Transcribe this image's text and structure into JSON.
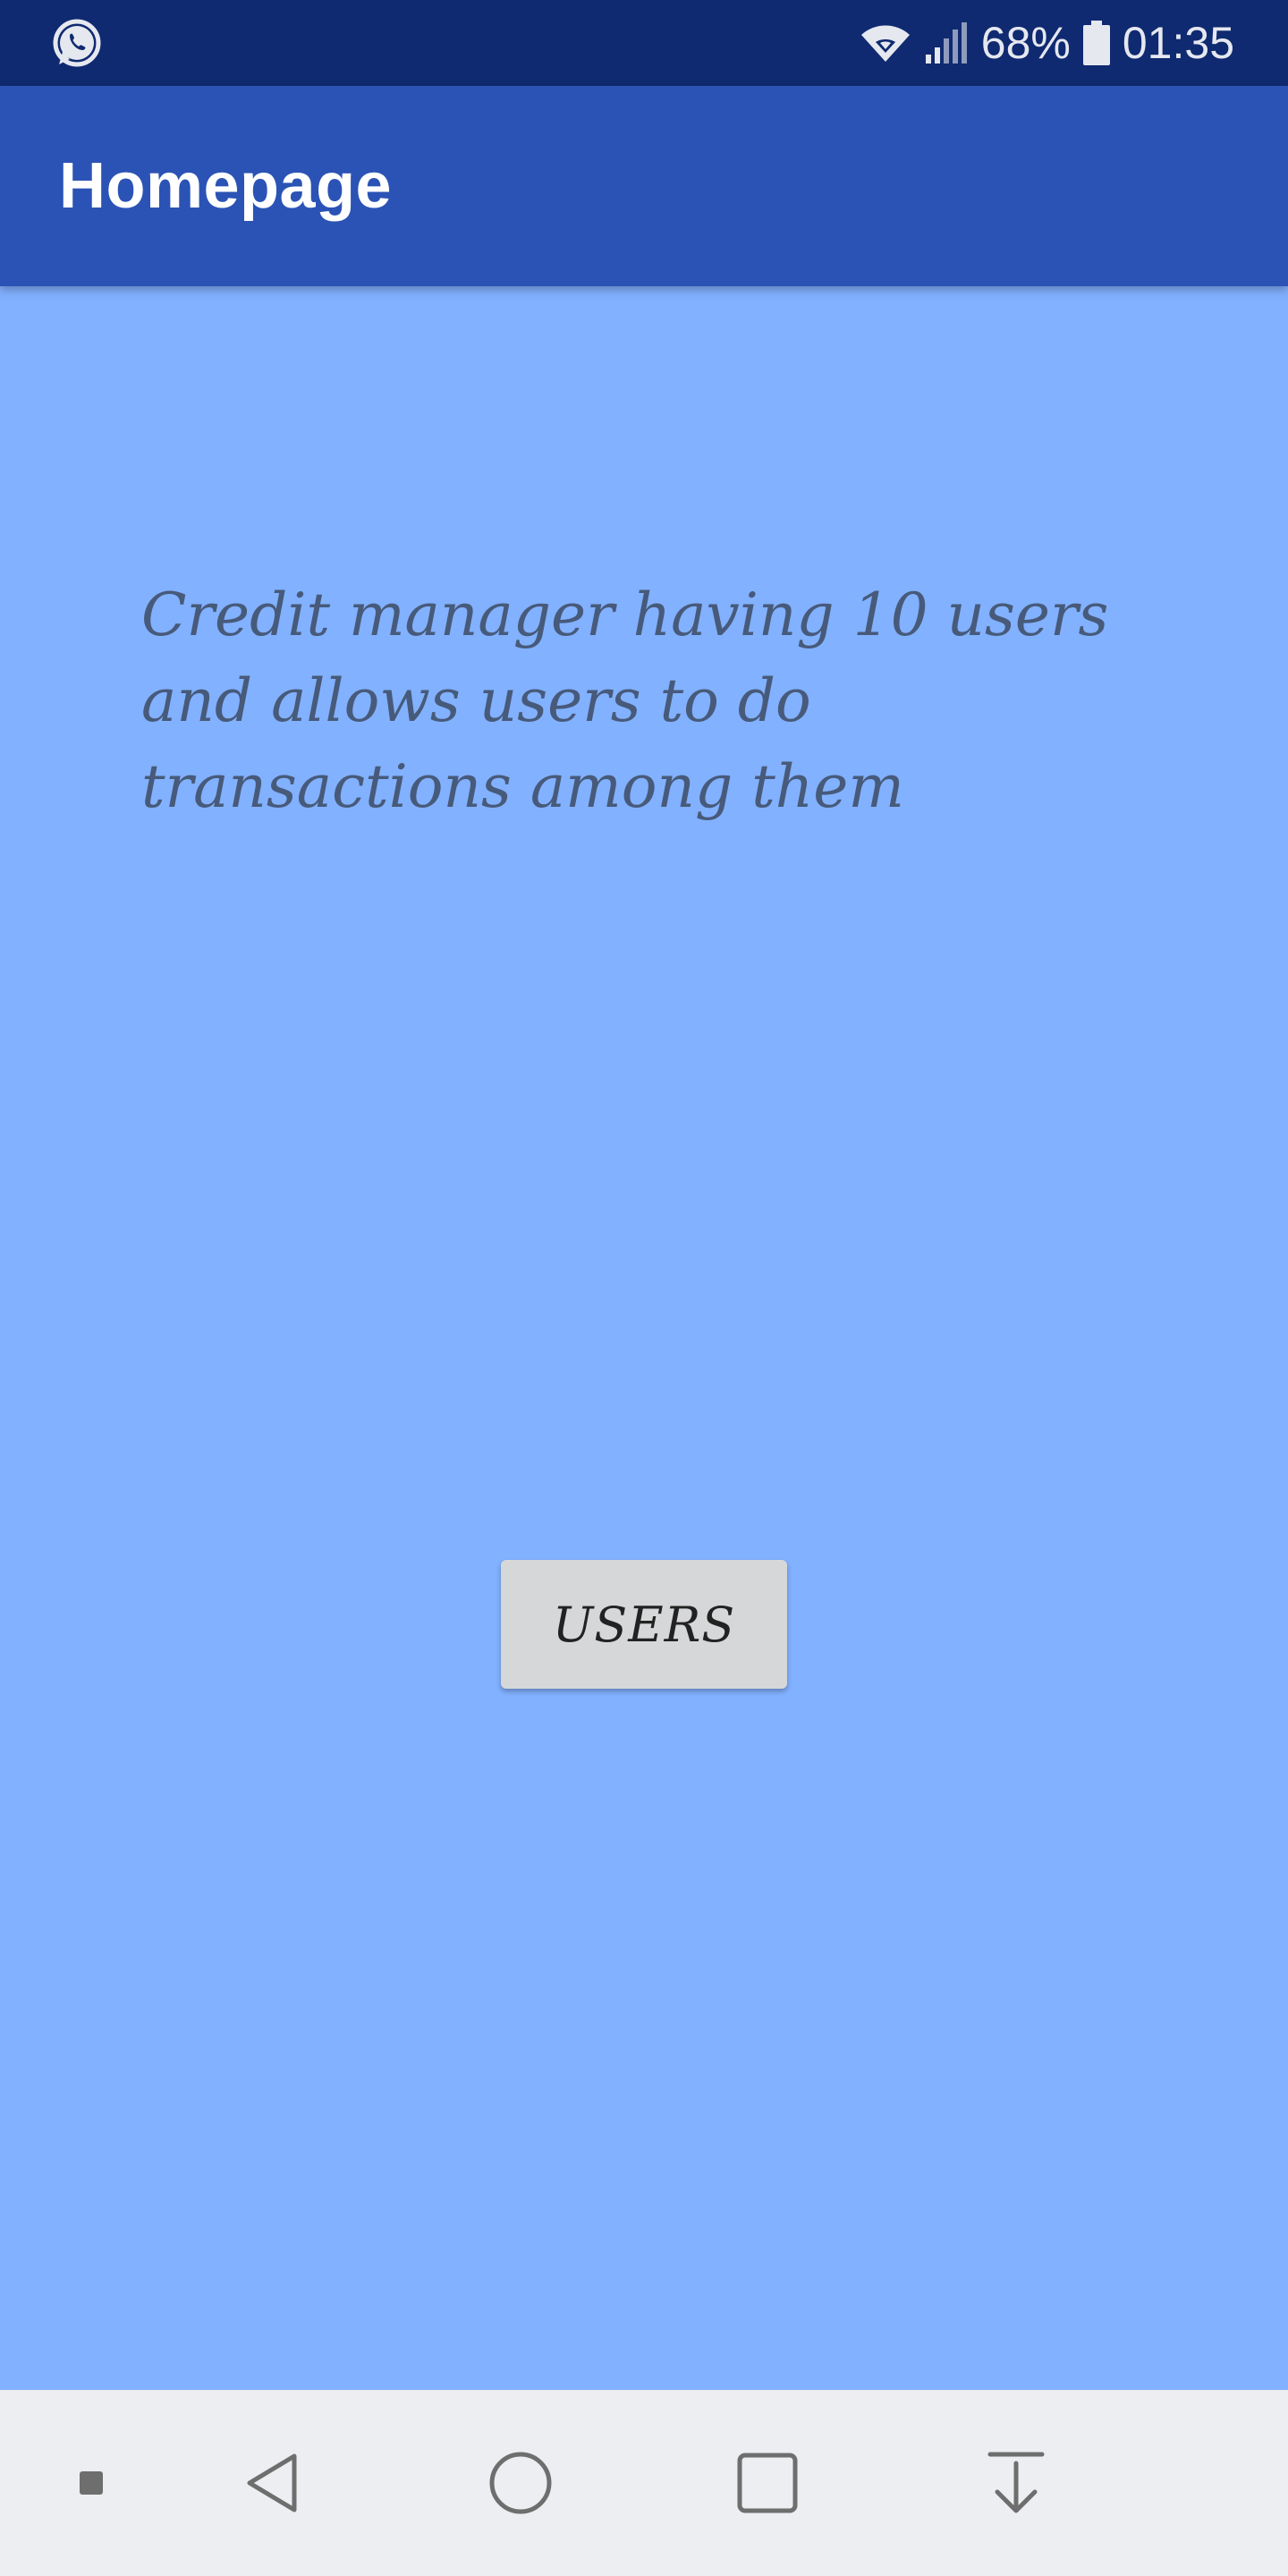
{
  "status_bar": {
    "battery_percent": "68%",
    "time": "01:35",
    "icons": [
      "whatsapp-icon",
      "wifi-icon",
      "signal-icon",
      "battery-icon"
    ]
  },
  "app_bar": {
    "title": "Homepage",
    "color": "#2b53b5"
  },
  "main": {
    "description": "Credit manager having 10 users and allows users to do transactions among them",
    "users_button_label": "USERS",
    "background_color": "#82b1ff"
  },
  "nav_bar": {
    "icons": [
      "dot-icon",
      "back-triangle-icon",
      "home-circle-icon",
      "recents-square-icon",
      "download-arrow-icon"
    ]
  }
}
